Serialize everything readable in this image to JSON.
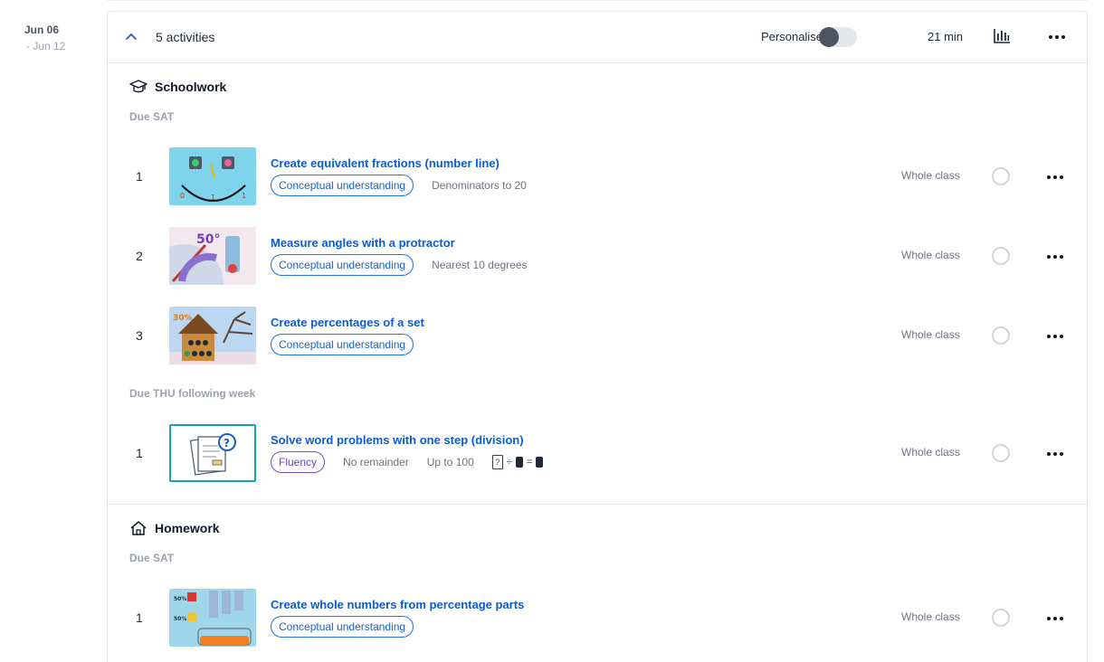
{
  "date": {
    "main": "Jun 06",
    "sub": "- Jun 12"
  },
  "header": {
    "activities": "5 activities",
    "personalise_label": "Personalise",
    "duration": "21 min"
  },
  "sections": [
    {
      "title": "Schoolwork",
      "icon": "graduation-cap-icon",
      "groups": [
        {
          "due": "Due SAT",
          "rows": [
            {
              "num": "1",
              "title": "Create equivalent fractions (number line)",
              "pill": "Conceptual understanding",
              "tags": [
                "Denominators to 20"
              ],
              "audience": "Whole class"
            },
            {
              "num": "2",
              "title": "Measure angles with a protractor",
              "pill": "Conceptual understanding",
              "tags": [
                "Nearest 10 degrees"
              ],
              "audience": "Whole class"
            },
            {
              "num": "3",
              "title": "Create percentages of a set",
              "pill": "Conceptual understanding",
              "tags": [],
              "audience": "Whole class"
            }
          ]
        },
        {
          "due": "Due THU following week",
          "rows": [
            {
              "num": "1",
              "title": "Solve word problems with one step (division)",
              "pill": "Fluency",
              "tags": [
                "No remainder",
                "Up to 100"
              ],
              "equation": {
                "q": "?",
                "op1": "÷",
                "op2": "="
              },
              "audience": "Whole class"
            }
          ]
        }
      ]
    },
    {
      "title": "Homework",
      "icon": "house-icon",
      "groups": [
        {
          "due": "Due SAT",
          "rows": [
            {
              "num": "1",
              "title": "Create whole numbers from percentage parts",
              "pill": "Conceptual understanding",
              "tags": [],
              "audience": "Whole class"
            }
          ]
        }
      ]
    }
  ],
  "thumbnails": {
    "fractions": {
      "digits": [
        "0",
        "1",
        "1"
      ]
    },
    "angles": {
      "label": "50°"
    },
    "percent_set": {
      "label": "30%"
    },
    "percent_parts": {
      "labels": [
        "50%",
        "50%"
      ]
    }
  },
  "colors": {
    "link": "#0b5bd3",
    "pill_border": "#1a73e8",
    "fluency": "#7c4ddb",
    "muted": "#9ca3af",
    "border": "#e5e7eb"
  }
}
